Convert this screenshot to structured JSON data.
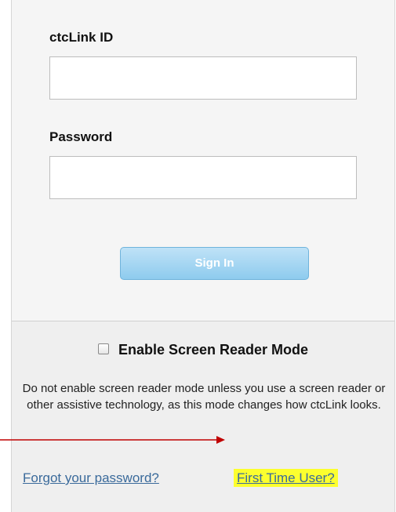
{
  "login": {
    "id_label": "ctcLink ID",
    "id_value": "",
    "password_label": "Password",
    "password_value": "",
    "signin_label": "Sign In"
  },
  "screen_reader": {
    "checkbox_label": "Enable Screen Reader Mode",
    "checked": false,
    "note": "Do not enable screen reader mode unless you use a screen reader or other assistive technology, as this mode changes how ctcLink looks."
  },
  "links": {
    "forgot_password": "Forgot your password?",
    "first_time_user": "First Time User?"
  },
  "colors": {
    "link": "#3a6a9b",
    "highlight": "#fcff2e",
    "arrow": "#c00000",
    "signin_button": "#8ecbee"
  }
}
